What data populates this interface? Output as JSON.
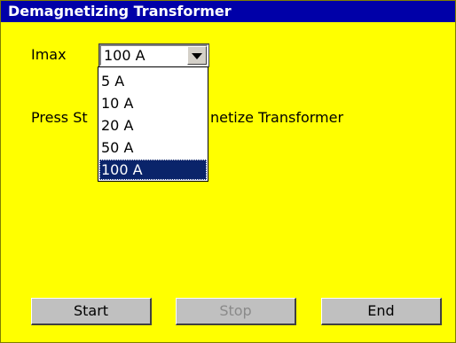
{
  "window": {
    "title": "Demagnetizing Transformer"
  },
  "imax": {
    "label": "Imax",
    "selected": "100 A",
    "options": [
      "5 A",
      "10 A",
      "20 A",
      "50 A",
      "100 A"
    ]
  },
  "instruction": {
    "text_left": "Press St",
    "text_right": "netize Transformer"
  },
  "buttons": {
    "start": "Start",
    "stop": "Stop",
    "end": "End"
  },
  "colors": {
    "background": "#ffff00",
    "titlebar": "#0000a8",
    "selection": "#0a246a"
  }
}
